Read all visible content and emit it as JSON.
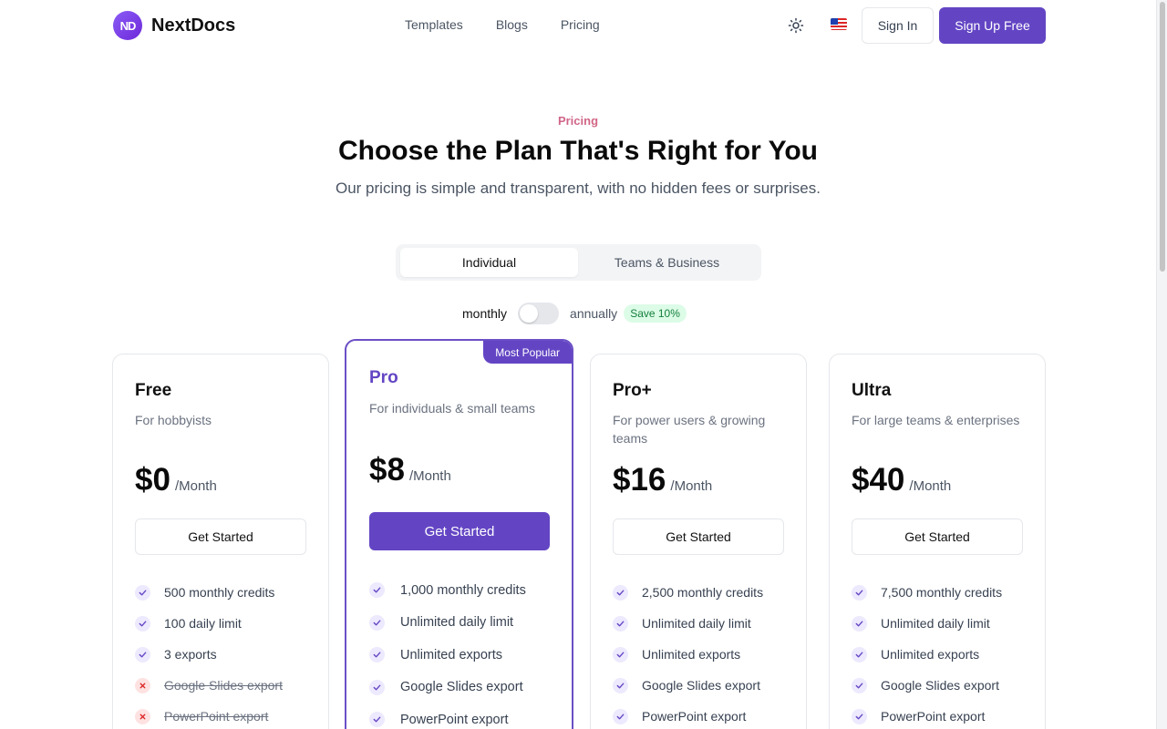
{
  "brand": {
    "logo_mark": "ND",
    "name": "NextDocs"
  },
  "nav": {
    "items": [
      "Templates",
      "Blogs",
      "Pricing"
    ]
  },
  "header": {
    "theme_icon": "sun-icon",
    "language_icon": "us-flag-icon",
    "sign_in": "Sign In",
    "sign_up": "Sign Up Free"
  },
  "hero": {
    "eyebrow": "Pricing",
    "title": "Choose the Plan That's Right for You",
    "subtitle": "Our pricing is simple and transparent, with no hidden fees or surprises."
  },
  "tabs": {
    "individual": "Individual",
    "teams": "Teams & Business",
    "active": "Individual"
  },
  "billing": {
    "monthly": "monthly",
    "annually": "annually",
    "save_badge": "Save 10%",
    "annual_selected": false
  },
  "colors": {
    "accent": "#6345c4",
    "check_bg": "#ede9fe",
    "cross_bg": "#fee2e2",
    "save_green": "#15803d"
  },
  "plans": [
    {
      "name": "Free",
      "description": "For hobbyists",
      "price": "$0",
      "period": "/Month",
      "cta": "Get Started",
      "features": [
        {
          "text": "500 monthly credits",
          "included": true
        },
        {
          "text": "100 daily limit",
          "included": true
        },
        {
          "text": "3 exports",
          "included": true
        },
        {
          "text": "Google Slides export",
          "included": false
        },
        {
          "text": "PowerPoint export",
          "included": false
        }
      ]
    },
    {
      "name": "Pro",
      "badge": "Most Popular",
      "description": "For individuals & small teams",
      "price": "$8",
      "period": "/Month",
      "cta": "Get Started",
      "features": [
        {
          "text": "1,000 monthly credits",
          "included": true
        },
        {
          "text": "Unlimited daily limit",
          "included": true
        },
        {
          "text": "Unlimited exports",
          "included": true
        },
        {
          "text": "Google Slides export",
          "included": true
        },
        {
          "text": "PowerPoint export",
          "included": true
        }
      ]
    },
    {
      "name": "Pro+",
      "description": "For power users & growing teams",
      "price": "$16",
      "period": "/Month",
      "cta": "Get Started",
      "features": [
        {
          "text": "2,500 monthly credits",
          "included": true
        },
        {
          "text": "Unlimited daily limit",
          "included": true
        },
        {
          "text": "Unlimited exports",
          "included": true
        },
        {
          "text": "Google Slides export",
          "included": true
        },
        {
          "text": "PowerPoint export",
          "included": true
        }
      ]
    },
    {
      "name": "Ultra",
      "description": "For large teams & enterprises",
      "price": "$40",
      "period": "/Month",
      "cta": "Get Started",
      "features": [
        {
          "text": "7,500 monthly credits",
          "included": true
        },
        {
          "text": "Unlimited daily limit",
          "included": true
        },
        {
          "text": "Unlimited exports",
          "included": true
        },
        {
          "text": "Google Slides export",
          "included": true
        },
        {
          "text": "PowerPoint export",
          "included": true
        }
      ]
    }
  ]
}
